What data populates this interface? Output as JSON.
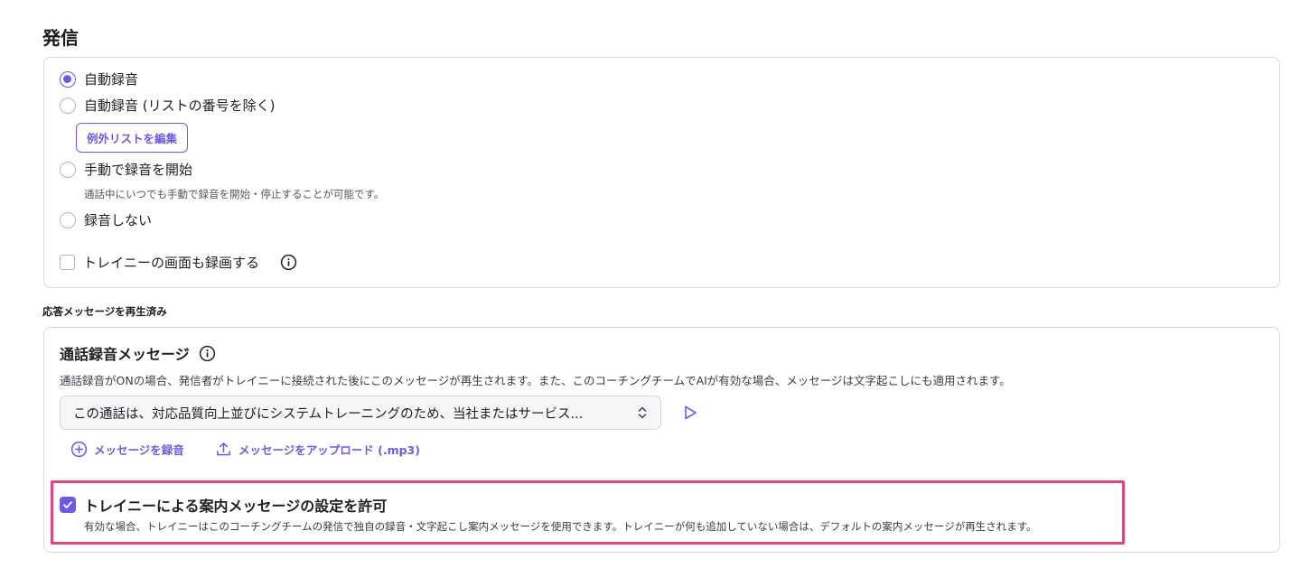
{
  "section": {
    "title": "発信"
  },
  "recording_options": {
    "selected": "自動録音",
    "auto": {
      "label": "自動録音"
    },
    "auto_except": {
      "label": "自動録音 (リストの番号を除く)",
      "edit_button": "例外リストを編集"
    },
    "manual": {
      "label": "手動で録音を開始",
      "helper": "通話中にいつでも手動で録音を開始・停止することが可能です。"
    },
    "none": {
      "label": "録音しない"
    },
    "screen_record": {
      "label": "トレイニーの画面も録画する",
      "checked": false
    }
  },
  "answer_message": {
    "heading": "応答メッセージを再生済み",
    "title": "通話録音メッセージ",
    "description": "通話録音がONの場合、発信者がトレイニーに接続された後にこのメッセージが再生されます。また、このコーチングチームでAIが有効な場合、メッセージは文字起こしにも適用されます。",
    "selected_message": "この通話は、対応品質向上並びにシステムトレーニングのため、当社またはサービス...",
    "record_link": "メッセージを録音",
    "upload_link": "メッセージをアップロード (.mp3)"
  },
  "trainee_permission": {
    "label": "トレイニーによる案内メッセージの設定を許可",
    "checked": true,
    "description": "有効な場合、トレイニーはこのコーチングチームの発信で独自の録音・文字起こし案内メッセージを使用できます。トレイニーが何も追加していない場合は、デフォルトの案内メッセージが再生されます。"
  },
  "colors": {
    "accent": "#6b5ce7",
    "highlight": "#e0457b",
    "border": "#d9d9de"
  }
}
